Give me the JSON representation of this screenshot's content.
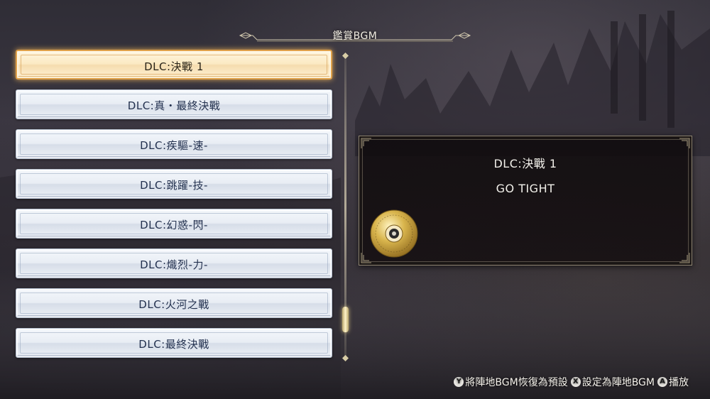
{
  "header": {
    "title": "鑑賞BGM"
  },
  "bgm_list": [
    {
      "label": "DLC:決戰 1",
      "selected": true
    },
    {
      "label": "DLC:真・最終決戰",
      "selected": false
    },
    {
      "label": "DLC:疾驅-速-",
      "selected": false
    },
    {
      "label": "DLC:跳躍-技-",
      "selected": false
    },
    {
      "label": "DLC:幻惑-閃-",
      "selected": false
    },
    {
      "label": "DLC:熾烈-力-",
      "selected": false
    },
    {
      "label": "DLC:火河之戰",
      "selected": false
    },
    {
      "label": "DLC:最終決戰",
      "selected": false
    }
  ],
  "info": {
    "title": "DLC:決戰 1",
    "artist": "GO TIGHT",
    "disc_icon": "disc-icon"
  },
  "footer": {
    "y_glyph": "Y",
    "y_action": "將陣地BGM恢復為預設",
    "x_glyph": "X",
    "x_action": "設定為陣地BGM",
    "a_glyph": "A",
    "a_action": "播放"
  },
  "colors": {
    "selected_border": "#e0a14a",
    "item_text": "#23314f",
    "panel_bg": "#140e10"
  }
}
